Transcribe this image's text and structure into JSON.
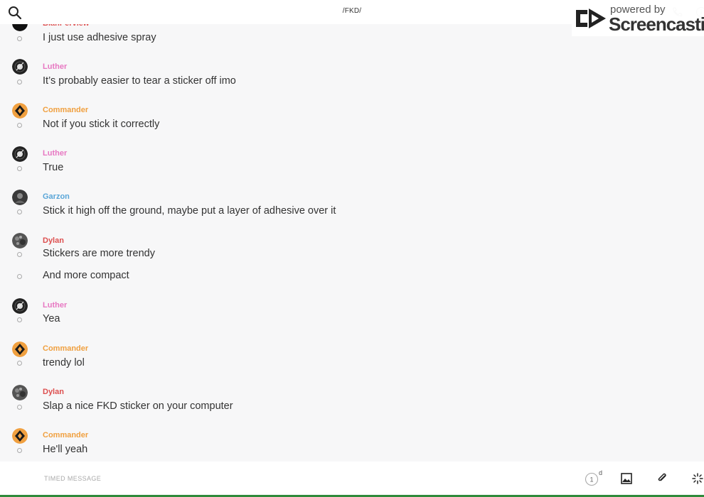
{
  "header": {
    "channel_title": "/FKD/",
    "watermark_powered": "powered by",
    "watermark_brand": "Screencastify"
  },
  "colors": {
    "luther": "#e778c2",
    "commander": "#f0a040",
    "garzon": "#5aa6d8",
    "dylan": "#dd4f4f",
    "partial": "#dd4f4f"
  },
  "messages": [
    {
      "sender": "",
      "text": "I just use adhesive spray",
      "avatar": "partial-avatar"
    },
    {
      "sender": "Luther",
      "text": "It’s probably easier to tear a sticker off imo",
      "avatar": "vinyl-avatar"
    },
    {
      "sender": "Commander",
      "text": "Not if you stick it correctly",
      "avatar": "diamond-avatar"
    },
    {
      "sender": "Luther",
      "text": "True",
      "avatar": "vinyl-avatar"
    },
    {
      "sender": "Garzon",
      "text": "Stick it high off the ground, maybe put a layer of adhesive over it",
      "avatar": "dark-avatar"
    },
    {
      "sender": "Dylan",
      "text": "Stickers are more trendy",
      "avatar": "texture-avatar"
    },
    {
      "sender": "",
      "text": "And more compact"
    },
    {
      "sender": "Luther",
      "text": "Yea",
      "avatar": "vinyl-avatar"
    },
    {
      "sender": "Commander",
      "text": "trendy lol",
      "avatar": "diamond-avatar"
    },
    {
      "sender": "Dylan",
      "text": "Slap a nice FKD sticker on your computer",
      "avatar": "texture-avatar"
    },
    {
      "sender": "Commander",
      "text": "He'll yeah",
      "avatar": "diamond-avatar"
    }
  ],
  "composer": {
    "placeholder": "TIMED MESSAGE",
    "timer_value": "1",
    "timer_unit": "d"
  }
}
